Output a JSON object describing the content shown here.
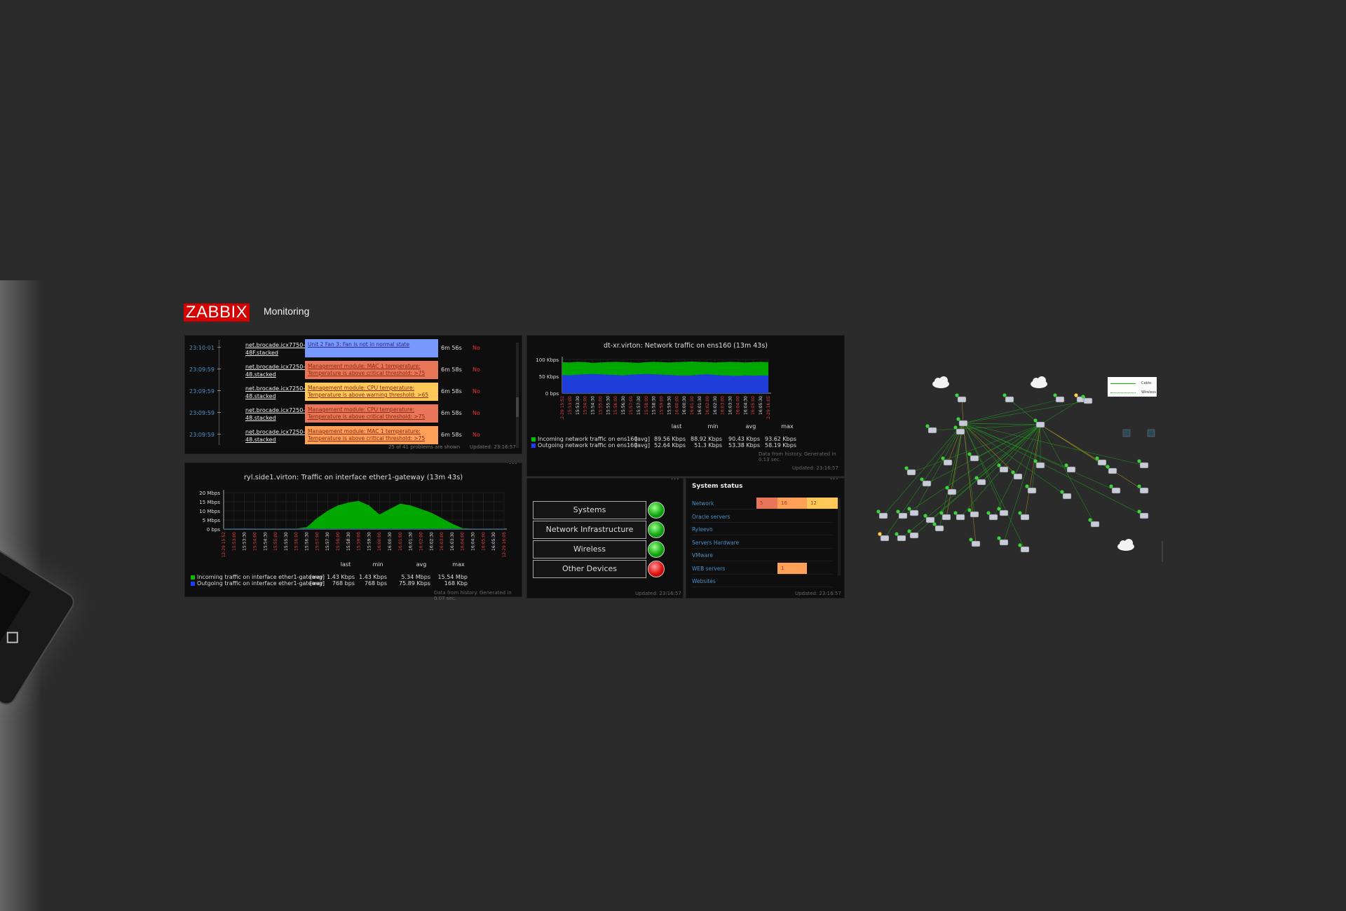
{
  "header": {
    "logo": "ZABBIX",
    "title": "Monitoring"
  },
  "problems": {
    "rows": [
      {
        "time": "23:10:01",
        "host": "net.brocade.icx7750-48F.stacked",
        "desc": "Unit 2 Fan 3: Fan is not in normal state",
        "duration": "6m 56s",
        "ack": "No",
        "color": "#7799ff"
      },
      {
        "time": "23:09:59",
        "host": "net.brocade.icx7250-48.stacked",
        "desc": "Management module: MAC 1 temperature: Temperature is above critical threshold: >75",
        "duration": "6m 58s",
        "ack": "No",
        "color": "#e97659"
      },
      {
        "time": "23:09:59",
        "host": "net.brocade.icx7250-48.stacked",
        "desc": "Management module: CPU temperature: Temperature is above warning threshold: >65",
        "duration": "6m 58s",
        "ack": "No",
        "color": "#ffc859"
      },
      {
        "time": "23:09:59",
        "host": "net.brocade.icx7250-48.stacked",
        "desc": "Management module: CPU temperature: Temperature is above critical threshold: >75",
        "duration": "6m 58s",
        "ack": "No",
        "color": "#e97659"
      },
      {
        "time": "23:09:59",
        "host": "net.brocade.icx7250-48.stacked",
        "desc": "Management module: MAC 1 temperature: Temperature is above critical threshold: >75",
        "duration": "6m 58s",
        "ack": "No",
        "color": "#ffa059"
      }
    ],
    "footer_count": "25 of 41 problems are shown",
    "updated": "Updated: 23:16:57"
  },
  "traffic_top": {
    "title": "dt-xr.virton: Network traffic on ens160 (13m 43s)",
    "y_ticks": [
      "100 Kbps",
      "50 Kbps",
      "0 bps"
    ],
    "x_ticks": [
      "12-29 15:52",
      "15:53:00",
      "15:53:30",
      "15:54:00",
      "15:54:30",
      "15:55:00",
      "15:55:30",
      "15:56:00",
      "15:56:30",
      "15:57:00",
      "15:57:30",
      "15:58:00",
      "15:58:30",
      "15:59:00",
      "15:59:30",
      "16:00:00",
      "16:00:30",
      "16:01:00",
      "16:01:30",
      "16:02:00",
      "16:02:30",
      "16:03:00",
      "16:03:30",
      "16:04:00",
      "16:04:30",
      "16:05:00",
      "16:05:30",
      "12-29 16:05"
    ],
    "headers": {
      "last": "last",
      "min": "min",
      "avg": "avg",
      "max": "max"
    },
    "series": [
      {
        "name": "Incoming network traffic on ens160",
        "fn": "[avg]",
        "last": "89.56 Kbps",
        "min": "88.92 Kbps",
        "avg": "90.43 Kbps",
        "max": "93.62 Kbps",
        "color": "#00c000"
      },
      {
        "name": "Outgoing network traffic on ens160",
        "fn": "[avg]",
        "last": "52.64 Kbps",
        "min": "51.3 Kbps",
        "avg": "53.38 Kbps",
        "max": "58.19 Kbps",
        "color": "#1e3cff"
      }
    ],
    "note": "Data from history. Generated in 0.13 sec.",
    "updated": "Updated: 23:16:57"
  },
  "traffic_bottom": {
    "title": "ryl.side1.virton: Traffic on interface ether1-gateway (13m 43s)",
    "y_ticks": [
      "20 Mbps",
      "15 Mbps",
      "10 Mbps",
      "5 Mbps",
      "0 bps"
    ],
    "x_ticks": [
      "12-29 15:52",
      "15:53:00",
      "15:53:30",
      "15:54:00",
      "15:54:30",
      "15:55:00",
      "15:55:30",
      "15:56:00",
      "15:56:30",
      "15:57:00",
      "15:57:30",
      "15:58:00",
      "15:58:30",
      "15:59:00",
      "15:59:30",
      "16:00:00",
      "16:00:30",
      "16:01:00",
      "16:01:30",
      "16:02:00",
      "16:02:30",
      "16:03:00",
      "16:03:30",
      "16:04:00",
      "16:04:30",
      "16:05:00",
      "16:05:30",
      "12-29 16:05"
    ],
    "headers": {
      "last": "last",
      "min": "min",
      "avg": "avg",
      "max": "max"
    },
    "series": [
      {
        "name": "Incoming traffic on interface ether1-gateway",
        "fn": "[avg]",
        "last": "1.43 Kbps",
        "min": "1.43 Kbps",
        "avg": "5.34 Mbps",
        "max": "15.54 Mbp",
        "color": "#00c000"
      },
      {
        "name": "Outgoing traffic on interface ether1-gateway",
        "fn": "[avg]",
        "last": "768 bps",
        "min": "768 bps",
        "avg": "75.89 Kbps",
        "max": "168 Kbp",
        "color": "#1e3cff"
      }
    ],
    "note": "Data from history. Generated in 0.07 sec.",
    "menu": "···"
  },
  "services": {
    "items": [
      {
        "label": "Systems",
        "status": "green"
      },
      {
        "label": "Network Infrastructure",
        "status": "green"
      },
      {
        "label": "Wireless",
        "status": "green"
      },
      {
        "label": "Other Devices",
        "status": "red"
      }
    ],
    "updated": "Updated: 23:16:57",
    "menu": "···"
  },
  "system_status": {
    "title": "System status",
    "rows": [
      {
        "name": "Network",
        "sev": [
          {
            "value": "5",
            "color": "#e97659"
          },
          {
            "value": "16",
            "color": "#ffa059"
          },
          {
            "value": "12",
            "color": "#ffc859"
          }
        ]
      },
      {
        "name": "Oracle servers",
        "sev": []
      },
      {
        "name": "Ryleevo",
        "sev": []
      },
      {
        "name": "Servers Hardware",
        "sev": []
      },
      {
        "name": "VMware",
        "sev": []
      },
      {
        "name": "WEB servers",
        "sev": [
          {
            "value": "1",
            "color": "#ffa059"
          }
        ]
      },
      {
        "name": "Websites",
        "sev": []
      }
    ],
    "updated": "Updated: 23:16:57",
    "menu": "···"
  },
  "map": {
    "legend": [
      {
        "label": "Cable",
        "color": "#00c000"
      },
      {
        "label": "Wireless",
        "color": "#00c000"
      }
    ]
  }
}
